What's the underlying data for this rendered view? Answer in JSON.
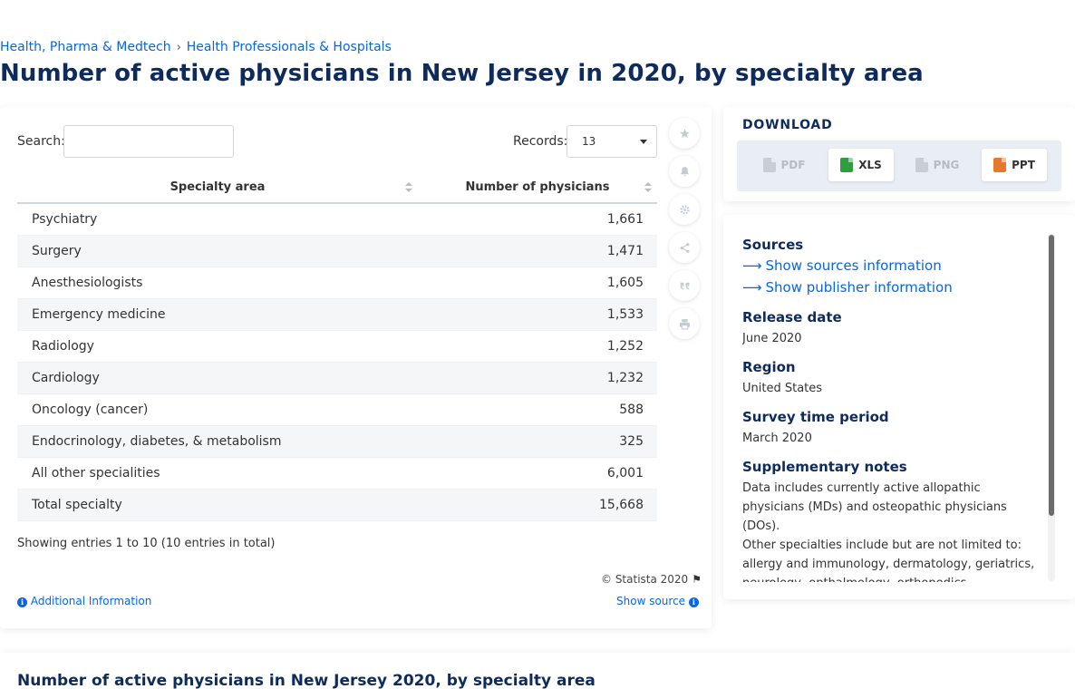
{
  "breadcrumb": {
    "items": [
      "Health, Pharma & Medtech",
      "Health Professionals & Hospitals"
    ],
    "separator": "›"
  },
  "page_title": "Number of active physicians in New Jersey in 2020, by specialty area",
  "table_controls": {
    "search_label": "Search:",
    "search_value": "",
    "records_label": "Records:",
    "records_value": "13"
  },
  "table": {
    "columns": [
      "Specialty area",
      "Number of physicians"
    ],
    "rows": [
      {
        "specialty": "Psychiatry",
        "number": "1,661"
      },
      {
        "specialty": "Surgery",
        "number": "1,471"
      },
      {
        "specialty": "Anesthesiologists",
        "number": "1,605"
      },
      {
        "specialty": "Emergency medicine",
        "number": "1,533"
      },
      {
        "specialty": "Radiology",
        "number": "1,252"
      },
      {
        "specialty": "Cardiology",
        "number": "1,232"
      },
      {
        "specialty": "Oncology (cancer)",
        "number": "588"
      },
      {
        "specialty": "Endocrinology, diabetes, & metabolism",
        "number": "325"
      },
      {
        "specialty": "All other specialities",
        "number": "6,001"
      },
      {
        "specialty": "Total specialty",
        "number": "15,668"
      }
    ]
  },
  "footer": {
    "entries_info": "Showing entries 1 to 10 (10 entries in total)",
    "copyright": "© Statista 2020",
    "additional_info": "Additional Information",
    "show_source": "Show source"
  },
  "toolbar": {
    "icons": [
      "star-icon",
      "bell-icon",
      "gear-icon",
      "share-icon",
      "quote-icon",
      "print-icon"
    ]
  },
  "download": {
    "title": "DOWNLOAD",
    "buttons": [
      {
        "label": "PDF",
        "enabled": false,
        "color": "#b6bcc4"
      },
      {
        "label": "XLS",
        "enabled": true,
        "color": "#2e9e3e"
      },
      {
        "label": "PNG",
        "enabled": false,
        "color": "#b6bcc4"
      },
      {
        "label": "PPT",
        "enabled": true,
        "color": "#e8772e"
      }
    ]
  },
  "info": {
    "sources_heading": "Sources",
    "show_sources": "Show sources information",
    "show_publisher": "Show publisher information",
    "release_heading": "Release date",
    "release_value": "June 2020",
    "region_heading": "Region",
    "region_value": "United States",
    "survey_heading": "Survey time period",
    "survey_value": "March 2020",
    "supplementary_heading": "Supplementary notes",
    "supplementary_p1": "Data includes currently active allopathic physicians (MDs) and osteopathic physicians (DOs).",
    "supplementary_p2": "Other specialties include but are not limited to: allergy and immunology, dermatology, geriatrics, neurology, opthalmology, orthopedics, otolaryngology, pathology, pediatrics, general"
  },
  "bottom_title": "Number of active physicians in New Jersey 2020, by specialty area",
  "colors": {
    "accent": "#0666e5",
    "title": "#0e2b5c",
    "xls": "#2e9e3e",
    "ppt": "#e8772e"
  }
}
